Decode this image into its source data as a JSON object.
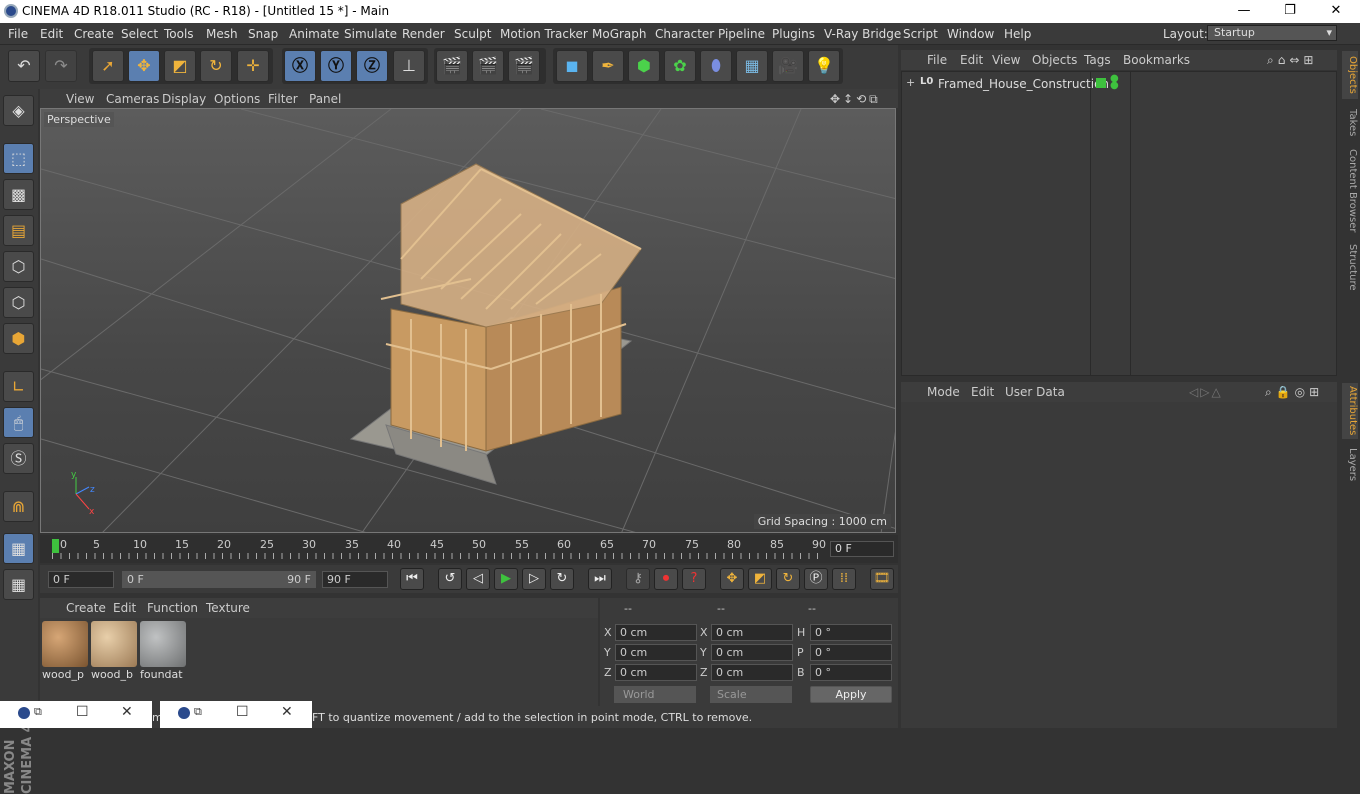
{
  "title": "CINEMA 4D R18.011 Studio (RC - R18) - [Untitled 15 *] - Main",
  "window_controls": {
    "minimize": "—",
    "maximize": "❐",
    "close": "✕"
  },
  "menu": [
    "File",
    "Edit",
    "Create",
    "Select",
    "Tools",
    "Mesh",
    "Snap",
    "Animate",
    "Simulate",
    "Render",
    "Sculpt",
    "Motion Tracker",
    "MoGraph",
    "Character",
    "Pipeline",
    "Plugins",
    "V-Ray Bridge",
    "Script",
    "Window",
    "Help"
  ],
  "layout": {
    "label": "Layout:",
    "value": "Startup"
  },
  "viewport_menu": [
    "View",
    "Cameras",
    "Display",
    "Options",
    "Filter",
    "Panel"
  ],
  "viewport": {
    "camera": "Perspective",
    "grid_spacing": "Grid Spacing : 1000 cm"
  },
  "timeline": {
    "ticks": [
      "0",
      "5",
      "10",
      "15",
      "20",
      "25",
      "30",
      "35",
      "40",
      "45",
      "50",
      "55",
      "60",
      "65",
      "70",
      "75",
      "80",
      "85",
      "90"
    ],
    "current_frame": "0 F"
  },
  "transport": {
    "start": "0 F",
    "range_start": "0 F",
    "range_end": "90 F",
    "end": "90 F"
  },
  "material_menu": [
    "Create",
    "Edit",
    "Function",
    "Texture"
  ],
  "materials": [
    {
      "label": "wood_p",
      "color": "#9c7447"
    },
    {
      "label": "wood_b",
      "color": "#c2a27e"
    },
    {
      "label": "foundat",
      "color": "#8f9192"
    }
  ],
  "coordinates": {
    "headers": [
      "--",
      "--",
      "--"
    ],
    "rows": [
      {
        "a": "X",
        "av": "0 cm",
        "b": "X",
        "bv": "0 cm",
        "c": "H",
        "cv": "0 °"
      },
      {
        "a": "Y",
        "av": "0 cm",
        "b": "Y",
        "bv": "0 cm",
        "c": "P",
        "cv": "0 °"
      },
      {
        "a": "Z",
        "av": "0 cm",
        "b": "Z",
        "bv": "0 cm",
        "c": "B",
        "cv": "0 °"
      }
    ],
    "space": "World",
    "mode": "Scale",
    "apply": "Apply"
  },
  "object_menu": [
    "File",
    "Edit",
    "View",
    "Objects",
    "Tags",
    "Bookmarks"
  ],
  "objects": [
    {
      "name": "Framed_House_Construction",
      "expand": "+",
      "layer_icon": "L0"
    }
  ],
  "attribute_menu": [
    "Mode",
    "Edit",
    "User Data"
  ],
  "side_tabs_top": [
    "Objects",
    "Takes",
    "Content Browser",
    "Structure"
  ],
  "side_tabs_bottom": [
    "Attributes",
    "Layers"
  ],
  "status": "FT to quantize movement / add to the selection in point mode, CTRL to remove.",
  "status_prefix": "mo",
  "taskbar": [
    {
      "min": "☐",
      "close": "✕"
    },
    {
      "min": "☐",
      "close": "✕"
    }
  ],
  "brand": "MAXON CINEMA 4D",
  "colors": {
    "accent": "#e8a636",
    "selected": "#5b7fb0",
    "object_enabled": "#3ec13e"
  }
}
